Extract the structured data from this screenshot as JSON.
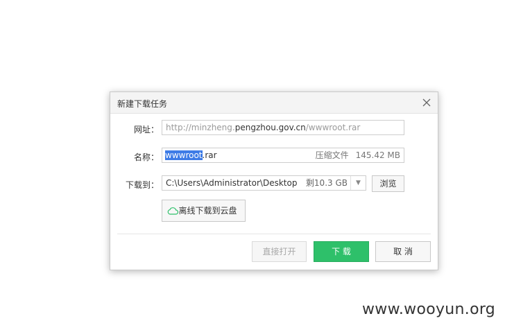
{
  "dialog": {
    "title": "新建下载任务",
    "url_label": "网址：",
    "url_prefix": "http://minzheng.",
    "url_host": "pengzhou.gov.cn",
    "url_suffix": "/wwwroot.rar",
    "name_label": "名称：",
    "name_selected": "wwwroot",
    "name_rest": ".rar",
    "file_type": "压缩文件",
    "file_size": "145.42 MB",
    "path_label": "下载到：",
    "path_value": "C:\\Users\\Administrator\\Desktop",
    "free_space": "剩10.3 GB",
    "browse_label": "浏览",
    "cloud_label": "离线下载到云盘",
    "open_label": "直接打开",
    "download_label": "下 载",
    "cancel_label": "取 消"
  },
  "watermark": "www.wooyun.org",
  "icons": {
    "close": "close-icon",
    "dropdown": "chevron-down-icon",
    "cloud": "cloud-icon"
  },
  "colors": {
    "accent": "#2ec06a",
    "selection": "#3d7be6"
  }
}
